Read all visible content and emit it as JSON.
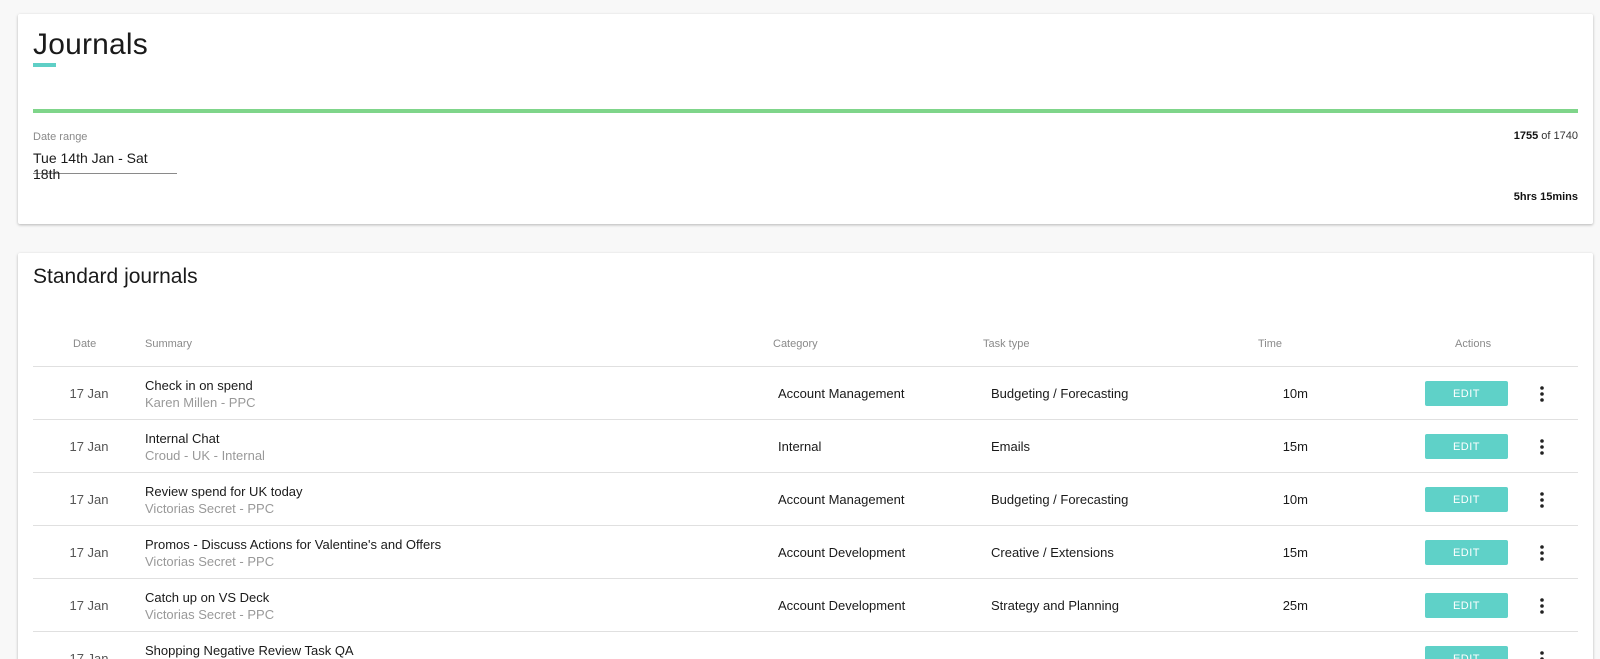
{
  "header": {
    "title": "Journals",
    "progress_fraction": 1.0,
    "date_range_label": "Date range",
    "date_range_value": "Tue 14th Jan - Sat 18th",
    "count_done": "1755",
    "count_of": "of 1740",
    "total_time": "5hrs 15mins"
  },
  "standard": {
    "title": "Standard journals",
    "columns": {
      "date": "Date",
      "summary": "Summary",
      "category": "Category",
      "task_type": "Task type",
      "time": "Time",
      "actions": "Actions"
    },
    "edit_label": "EDIT",
    "rows": [
      {
        "date": "17 Jan",
        "title": "Check in on spend",
        "subtitle": "Karen Millen - PPC",
        "category": "Account Management",
        "task_type": "Budgeting / Forecasting",
        "time": "10m"
      },
      {
        "date": "17 Jan",
        "title": "Internal Chat",
        "subtitle": "Croud - UK - Internal",
        "category": "Internal",
        "task_type": "Emails",
        "time": "15m"
      },
      {
        "date": "17 Jan",
        "title": "Review spend for UK today",
        "subtitle": "Victorias Secret - PPC",
        "category": "Account Management",
        "task_type": "Budgeting / Forecasting",
        "time": "10m"
      },
      {
        "date": "17 Jan",
        "title": "Promos - Discuss Actions for Valentine's and Offers",
        "subtitle": "Victorias Secret - PPC",
        "category": "Account Development",
        "task_type": "Creative / Extensions",
        "time": "15m"
      },
      {
        "date": "17 Jan",
        "title": "Catch up on VS Deck",
        "subtitle": "Victorias Secret - PPC",
        "category": "Account Development",
        "task_type": "Strategy and Planning",
        "time": "25m"
      },
      {
        "date": "17 Jan",
        "title": "Shopping Negative Review Task QA",
        "subtitle": "",
        "category": "",
        "task_type": "",
        "time": ""
      }
    ]
  },
  "colors": {
    "accent": "#5fd1c8",
    "progress": "#7fd58a"
  }
}
